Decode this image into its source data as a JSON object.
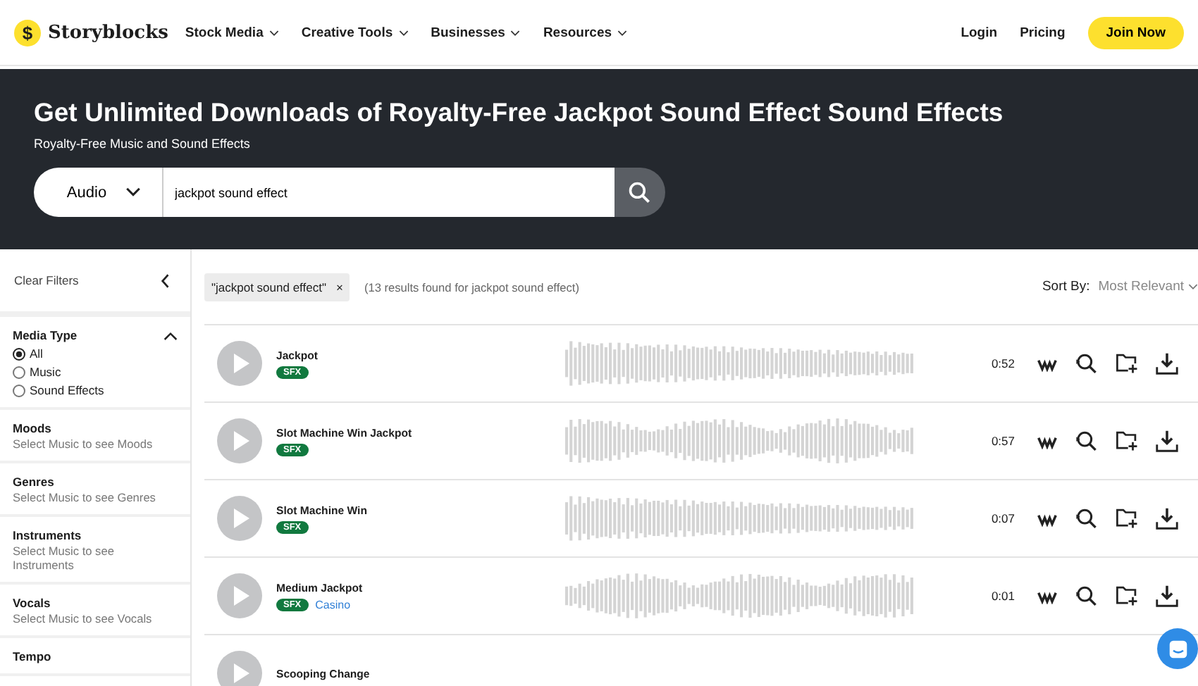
{
  "header": {
    "logo_mark": "$",
    "logo": "Storyblocks",
    "nav": [
      {
        "label": "Stock Media"
      },
      {
        "label": "Creative Tools"
      },
      {
        "label": "Businesses"
      },
      {
        "label": "Resources"
      }
    ],
    "links": [
      "Login",
      "Pricing"
    ],
    "cta": "Join Now"
  },
  "hero": {
    "title": "Get Unlimited Downloads of Royalty-Free Jackpot Sound Effect Sound Effects",
    "subtitle": "Royalty-Free Music and Sound Effects",
    "search": {
      "category": "Audio",
      "value": "jackpot sound effect"
    }
  },
  "sidebar": {
    "clear": "Clear Filters",
    "sections": [
      {
        "kind": "radio",
        "title": "Media Type",
        "expanded": true,
        "options": [
          {
            "label": "All",
            "selected": true
          },
          {
            "label": "Music",
            "selected": false
          },
          {
            "label": "Sound Effects",
            "selected": false
          }
        ]
      },
      {
        "kind": "hint",
        "title": "Moods",
        "hint": "Select Music to see Moods"
      },
      {
        "kind": "hint",
        "title": "Genres",
        "hint": "Select Music to see Genres"
      },
      {
        "kind": "hint",
        "title": "Instruments",
        "hint": "Select Music to see Instruments"
      },
      {
        "kind": "hint",
        "title": "Vocals",
        "hint": "Select Music to see Vocals"
      },
      {
        "kind": "hint",
        "title": "Tempo"
      }
    ]
  },
  "results": {
    "filter_chip": "\"jackpot sound effect\"",
    "chip_close": "×",
    "count": "(13 results found for jackpot sound effect)",
    "sort_label": "Sort By:",
    "sort_value": "Most Relevant",
    "rows": [
      {
        "title": "Jackpot",
        "tag": "SFX",
        "duration": "0:52"
      },
      {
        "title": "Slot Machine Win Jackpot",
        "tag": "SFX",
        "duration": "0:57"
      },
      {
        "title": "Slot Machine Win",
        "tag": "SFX",
        "duration": "0:07"
      },
      {
        "title": "Medium Jackpot",
        "tag": "SFX",
        "category": "Casino",
        "duration": "0:01"
      },
      {
        "title": "Scooping Change"
      }
    ]
  }
}
